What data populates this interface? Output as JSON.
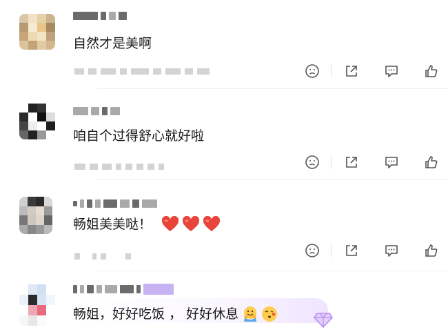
{
  "comments": [
    {
      "text": "自然才是美啊",
      "emojis": []
    },
    {
      "text": "咱自个过得舒心就好啦",
      "emojis": []
    },
    {
      "text": "畅姐美美哒！",
      "emojis": [
        "heart",
        "heart",
        "heart"
      ]
    },
    {
      "text": "畅姐，好好吃饭 ， 好好休息",
      "emojis": [
        "hug-emoji",
        "kiss-emoji"
      ]
    }
  ],
  "actions": [
    "dislike-icon",
    "share-icon",
    "reply-icon",
    "like-icon"
  ],
  "colors": {
    "heart": "#e8443a",
    "icon": "#555555",
    "badge": "#b98af0"
  }
}
